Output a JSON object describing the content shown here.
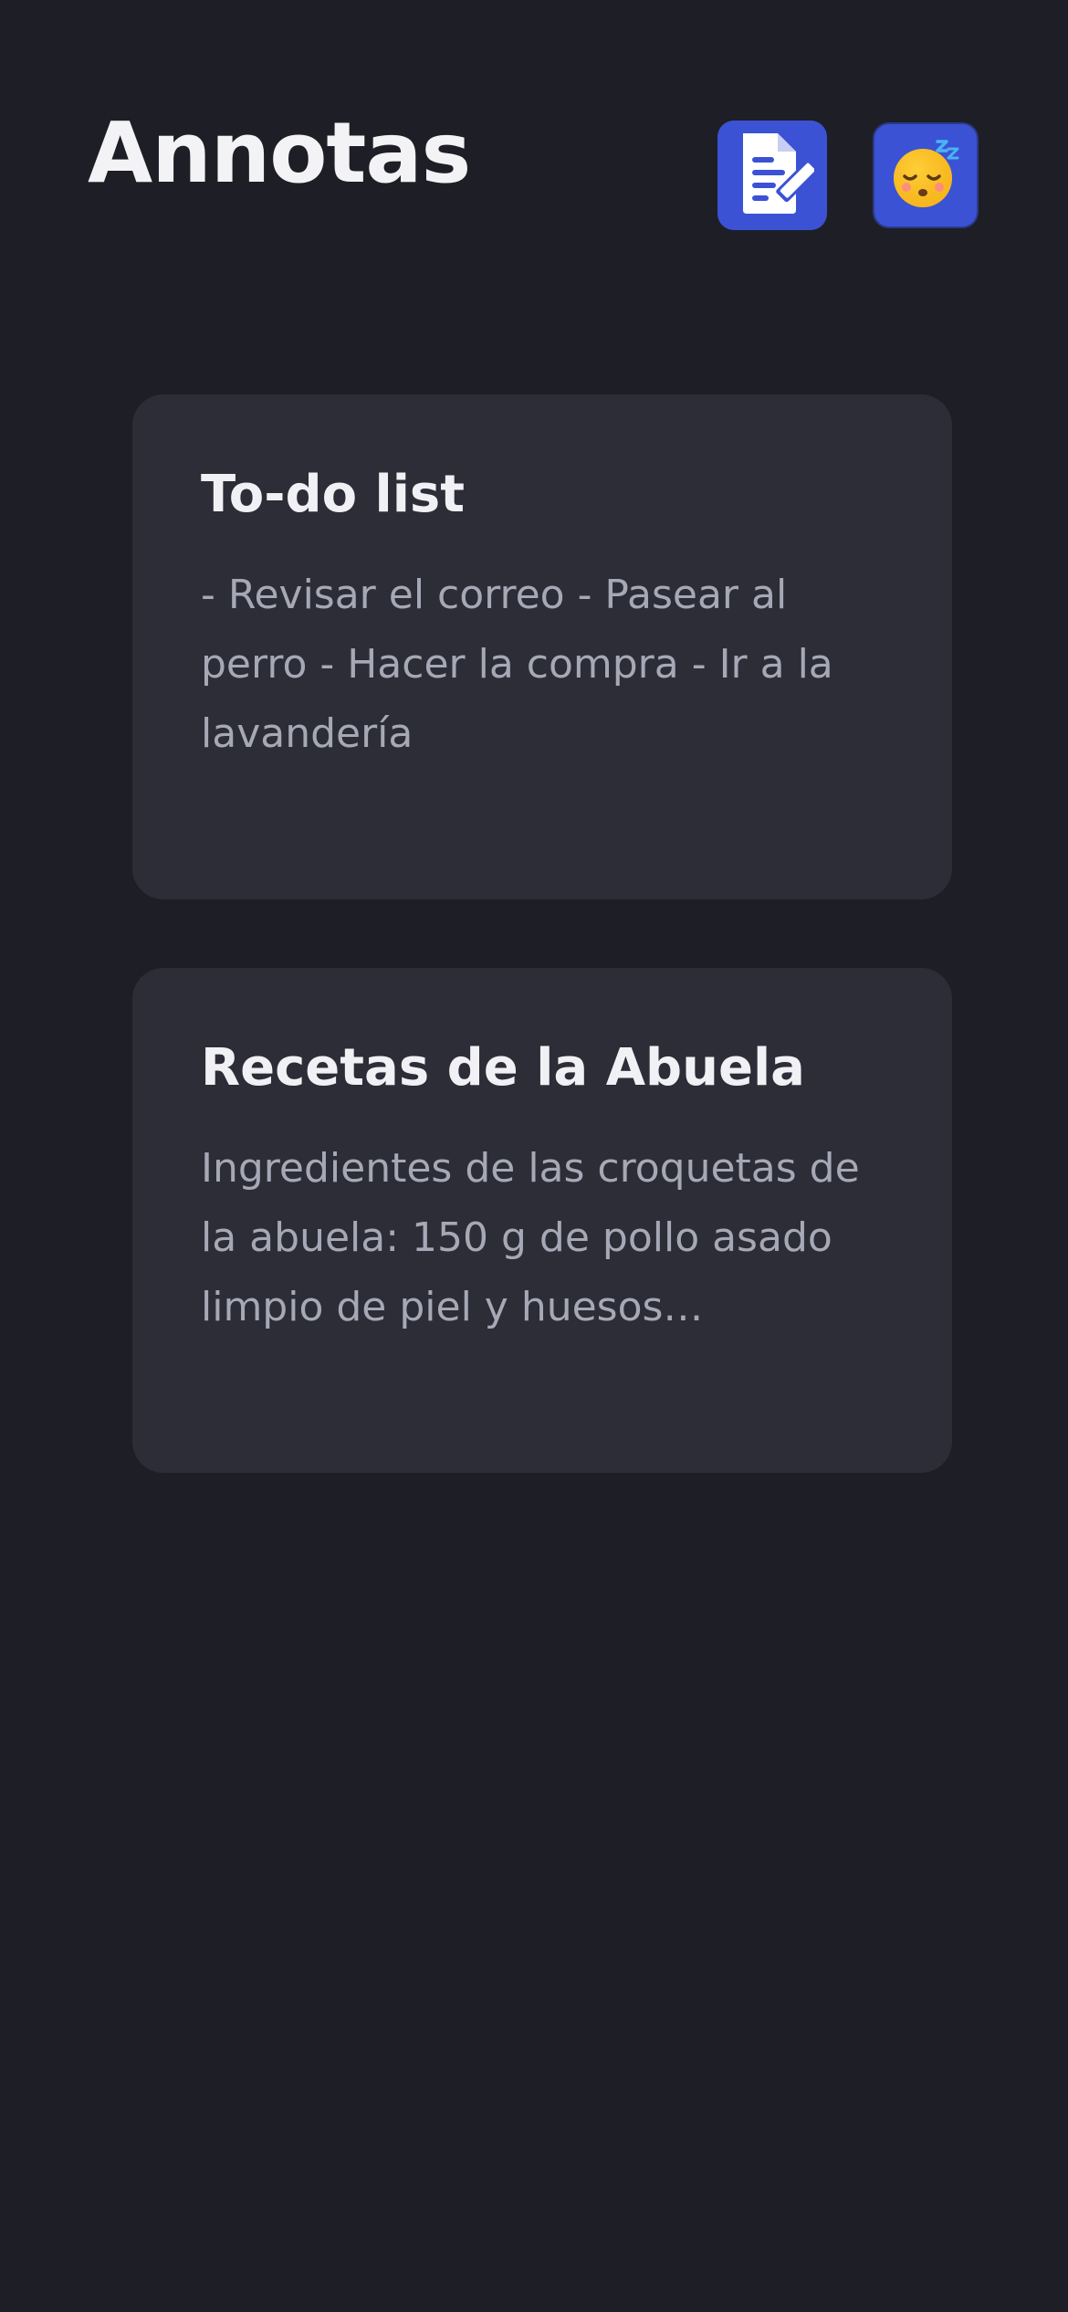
{
  "app": {
    "title": "Annotas"
  },
  "header": {
    "new_note_icon": "document-edit-icon",
    "theme_toggle_icon": "sleeping-face-icon"
  },
  "colors": {
    "background": "#1e1e26",
    "card": "#2c2d37",
    "accent": "#3b52d4",
    "title_text": "#f3f3f6",
    "body_text": "#a6a8b6"
  },
  "notes": [
    {
      "title": "To-do list",
      "body": "- Revisar el correo - Pasear al perro - Hacer la compra - Ir a la lavandería"
    },
    {
      "title": "Recetas de la Abuela",
      "body": "Ingredientes de las croquetas de la abuela: 150 g de pollo asado limpio de piel y huesos…"
    }
  ]
}
